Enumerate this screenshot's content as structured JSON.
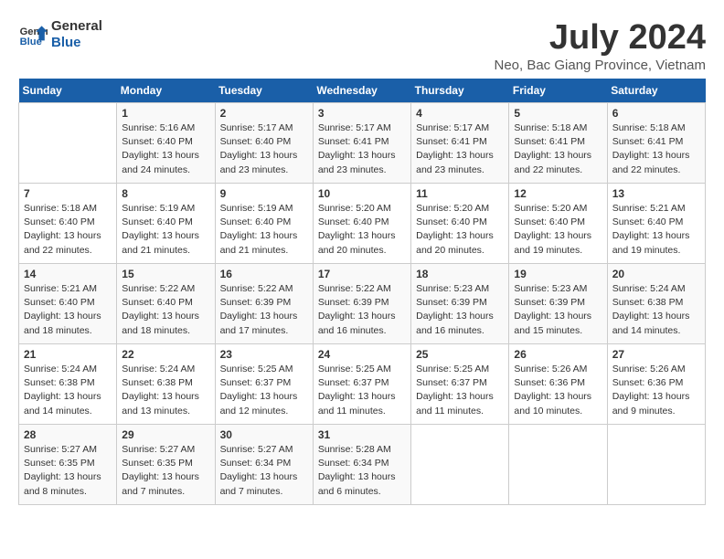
{
  "logo": {
    "line1": "General",
    "line2": "Blue"
  },
  "title": "July 2024",
  "subtitle": "Neo, Bac Giang Province, Vietnam",
  "days_of_week": [
    "Sunday",
    "Monday",
    "Tuesday",
    "Wednesday",
    "Thursday",
    "Friday",
    "Saturday"
  ],
  "weeks": [
    [
      {
        "num": "",
        "info": ""
      },
      {
        "num": "1",
        "info": "Sunrise: 5:16 AM\nSunset: 6:40 PM\nDaylight: 13 hours\nand 24 minutes."
      },
      {
        "num": "2",
        "info": "Sunrise: 5:17 AM\nSunset: 6:40 PM\nDaylight: 13 hours\nand 23 minutes."
      },
      {
        "num": "3",
        "info": "Sunrise: 5:17 AM\nSunset: 6:41 PM\nDaylight: 13 hours\nand 23 minutes."
      },
      {
        "num": "4",
        "info": "Sunrise: 5:17 AM\nSunset: 6:41 PM\nDaylight: 13 hours\nand 23 minutes."
      },
      {
        "num": "5",
        "info": "Sunrise: 5:18 AM\nSunset: 6:41 PM\nDaylight: 13 hours\nand 22 minutes."
      },
      {
        "num": "6",
        "info": "Sunrise: 5:18 AM\nSunset: 6:41 PM\nDaylight: 13 hours\nand 22 minutes."
      }
    ],
    [
      {
        "num": "7",
        "info": "Sunrise: 5:18 AM\nSunset: 6:40 PM\nDaylight: 13 hours\nand 22 minutes."
      },
      {
        "num": "8",
        "info": "Sunrise: 5:19 AM\nSunset: 6:40 PM\nDaylight: 13 hours\nand 21 minutes."
      },
      {
        "num": "9",
        "info": "Sunrise: 5:19 AM\nSunset: 6:40 PM\nDaylight: 13 hours\nand 21 minutes."
      },
      {
        "num": "10",
        "info": "Sunrise: 5:20 AM\nSunset: 6:40 PM\nDaylight: 13 hours\nand 20 minutes."
      },
      {
        "num": "11",
        "info": "Sunrise: 5:20 AM\nSunset: 6:40 PM\nDaylight: 13 hours\nand 20 minutes."
      },
      {
        "num": "12",
        "info": "Sunrise: 5:20 AM\nSunset: 6:40 PM\nDaylight: 13 hours\nand 19 minutes."
      },
      {
        "num": "13",
        "info": "Sunrise: 5:21 AM\nSunset: 6:40 PM\nDaylight: 13 hours\nand 19 minutes."
      }
    ],
    [
      {
        "num": "14",
        "info": "Sunrise: 5:21 AM\nSunset: 6:40 PM\nDaylight: 13 hours\nand 18 minutes."
      },
      {
        "num": "15",
        "info": "Sunrise: 5:22 AM\nSunset: 6:40 PM\nDaylight: 13 hours\nand 18 minutes."
      },
      {
        "num": "16",
        "info": "Sunrise: 5:22 AM\nSunset: 6:39 PM\nDaylight: 13 hours\nand 17 minutes."
      },
      {
        "num": "17",
        "info": "Sunrise: 5:22 AM\nSunset: 6:39 PM\nDaylight: 13 hours\nand 16 minutes."
      },
      {
        "num": "18",
        "info": "Sunrise: 5:23 AM\nSunset: 6:39 PM\nDaylight: 13 hours\nand 16 minutes."
      },
      {
        "num": "19",
        "info": "Sunrise: 5:23 AM\nSunset: 6:39 PM\nDaylight: 13 hours\nand 15 minutes."
      },
      {
        "num": "20",
        "info": "Sunrise: 5:24 AM\nSunset: 6:38 PM\nDaylight: 13 hours\nand 14 minutes."
      }
    ],
    [
      {
        "num": "21",
        "info": "Sunrise: 5:24 AM\nSunset: 6:38 PM\nDaylight: 13 hours\nand 14 minutes."
      },
      {
        "num": "22",
        "info": "Sunrise: 5:24 AM\nSunset: 6:38 PM\nDaylight: 13 hours\nand 13 minutes."
      },
      {
        "num": "23",
        "info": "Sunrise: 5:25 AM\nSunset: 6:37 PM\nDaylight: 13 hours\nand 12 minutes."
      },
      {
        "num": "24",
        "info": "Sunrise: 5:25 AM\nSunset: 6:37 PM\nDaylight: 13 hours\nand 11 minutes."
      },
      {
        "num": "25",
        "info": "Sunrise: 5:25 AM\nSunset: 6:37 PM\nDaylight: 13 hours\nand 11 minutes."
      },
      {
        "num": "26",
        "info": "Sunrise: 5:26 AM\nSunset: 6:36 PM\nDaylight: 13 hours\nand 10 minutes."
      },
      {
        "num": "27",
        "info": "Sunrise: 5:26 AM\nSunset: 6:36 PM\nDaylight: 13 hours\nand 9 minutes."
      }
    ],
    [
      {
        "num": "28",
        "info": "Sunrise: 5:27 AM\nSunset: 6:35 PM\nDaylight: 13 hours\nand 8 minutes."
      },
      {
        "num": "29",
        "info": "Sunrise: 5:27 AM\nSunset: 6:35 PM\nDaylight: 13 hours\nand 7 minutes."
      },
      {
        "num": "30",
        "info": "Sunrise: 5:27 AM\nSunset: 6:34 PM\nDaylight: 13 hours\nand 7 minutes."
      },
      {
        "num": "31",
        "info": "Sunrise: 5:28 AM\nSunset: 6:34 PM\nDaylight: 13 hours\nand 6 minutes."
      },
      {
        "num": "",
        "info": ""
      },
      {
        "num": "",
        "info": ""
      },
      {
        "num": "",
        "info": ""
      }
    ]
  ]
}
